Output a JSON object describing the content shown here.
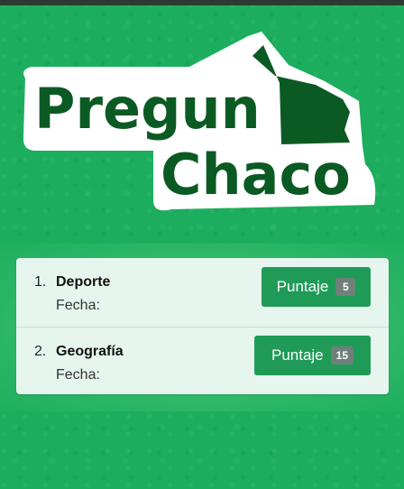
{
  "app": {
    "logo_line1": "Pregun",
    "logo_line2": "Chaco"
  },
  "colors": {
    "background": "#1cae5e",
    "logo_text": "#0c5a23",
    "button": "#1f9b57",
    "card": "#e6f6ef"
  },
  "results": [
    {
      "number": "1.",
      "title": "Deporte",
      "date_label": "Fecha:",
      "button_label": "Puntaje",
      "score": "5"
    },
    {
      "number": "2.",
      "title": "Geografía",
      "date_label": "Fecha:",
      "button_label": "Puntaje",
      "score": "15"
    }
  ]
}
